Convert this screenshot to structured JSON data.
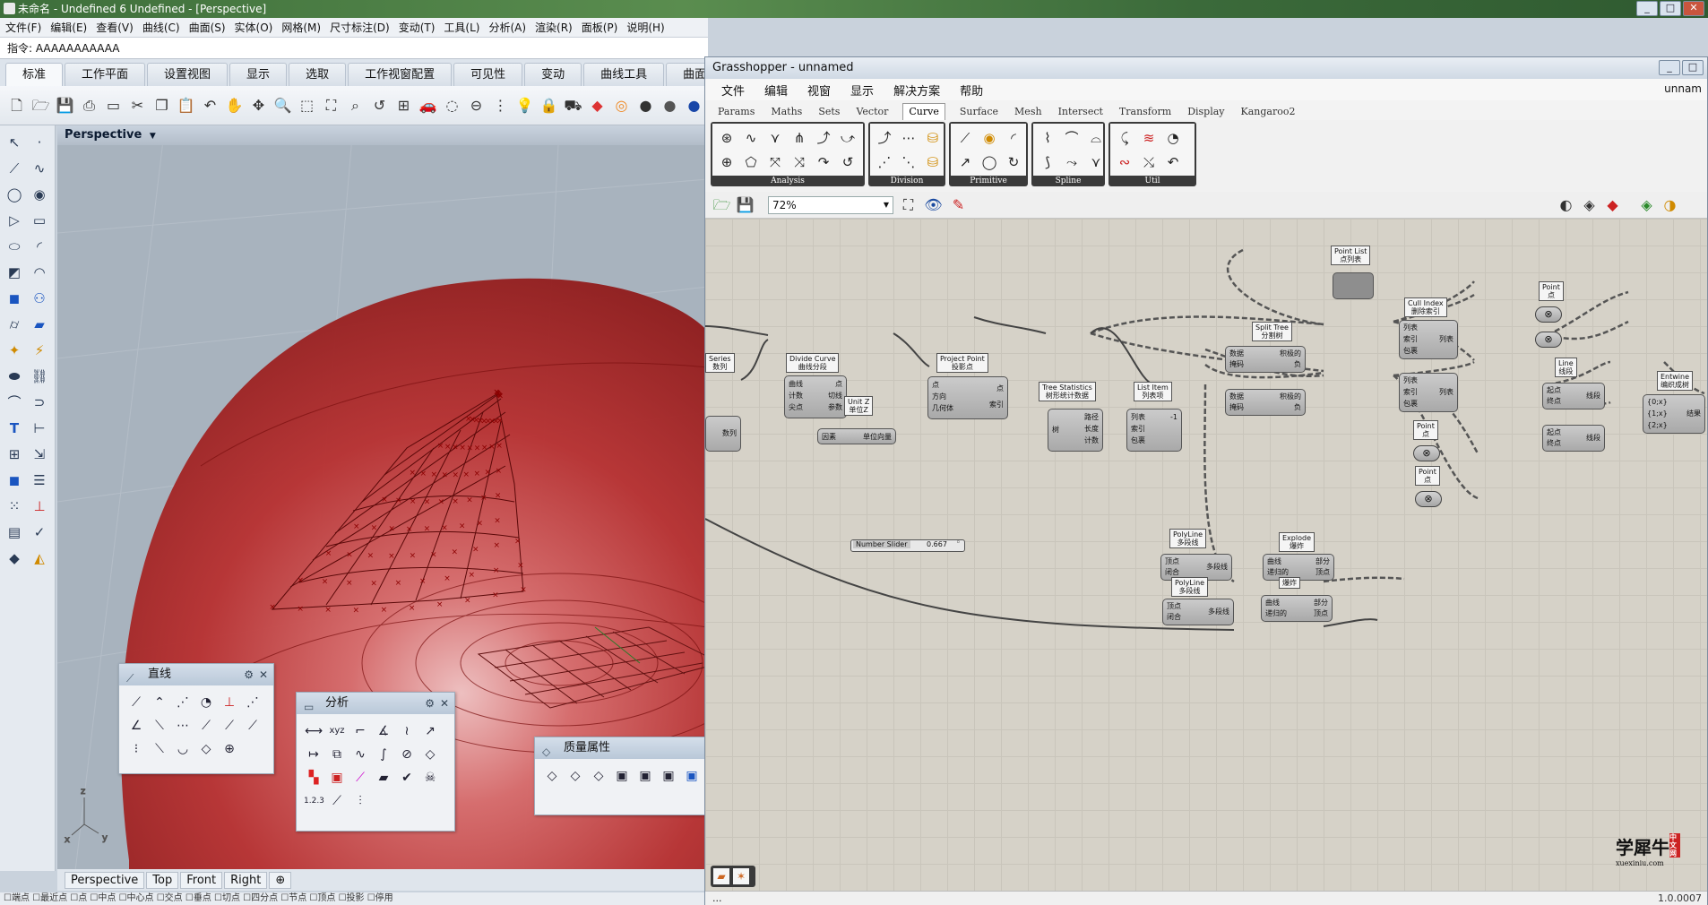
{
  "rhino": {
    "title": "未命名 - Undefined 6 Undefined - [Perspective]",
    "window_controls": [
      "_",
      "□",
      "✕"
    ],
    "menu": [
      "文件(F)",
      "编辑(E)",
      "查看(V)",
      "曲线(C)",
      "曲面(S)",
      "实体(O)",
      "网格(M)",
      "尺寸标注(D)",
      "变动(T)",
      "工具(L)",
      "分析(A)",
      "渲染(R)",
      "面板(P)",
      "说明(H)"
    ],
    "command": "指令: AAAAAAAAAAA",
    "tabs": [
      "标准",
      "工作平面",
      "设置视图",
      "显示",
      "选取",
      "工作视窗配置",
      "可见性",
      "变动",
      "曲线工具",
      "曲面工"
    ],
    "viewport_title": "Perspective",
    "viewport_tabs": [
      "Perspective",
      "Top",
      "Front",
      "Right",
      "⊕"
    ],
    "status": "☐端点 ☐最近点 ☐点 ☐中点 ☐中心点 ☐交点 ☐垂点 ☐切点 ☐四分点 ☐节点 ☐顶点 ☐投影 ☐停用",
    "axis_labels": {
      "z": "z",
      "x": "x",
      "y": "y"
    }
  },
  "panels": {
    "line": {
      "title": "直线",
      "gear": "⚙",
      "close": "✕"
    },
    "analysis": {
      "title": "分析",
      "gear": "⚙",
      "close": "✕",
      "number_label": "1.2.3"
    },
    "mass": {
      "title": "质量属性",
      "gear": "⚙",
      "close": "✕"
    }
  },
  "gh": {
    "title": "Grasshopper - unnamed",
    "menu": [
      "文件",
      "编辑",
      "视窗",
      "显示",
      "解决方案",
      "帮助"
    ],
    "menu_right": "unnam",
    "tabs": [
      "Params",
      "Maths",
      "Sets",
      "Vector",
      "Curve",
      "Surface",
      "Mesh",
      "Intersect",
      "Transform",
      "Display",
      "Kangaroo2"
    ],
    "active_tab": "Curve",
    "ribbon_groups": [
      "Analysis",
      "Division",
      "Primitive",
      "Spline",
      "Util"
    ],
    "zoom": "72%",
    "status_left": "...",
    "version": "1.0.0007",
    "slider_label": "Number Slider",
    "slider_value": "0.667",
    "watermark": "学犀牛",
    "watermark_badge": "中文网",
    "watermark_sub": "xuexiniu.com"
  },
  "nodes": {
    "series": {
      "tag": "Series",
      "tag2": "数列",
      "out": "数列"
    },
    "divide": {
      "tag": "Divide Curve",
      "tag2": "曲线分段",
      "in1": "曲线",
      "in2": "计数",
      "in3": "尖点",
      "out1": "点",
      "out2": "切线",
      "out3": "参数"
    },
    "unitz": {
      "tag": "Unit Z",
      "tag2": "单位Z",
      "in": "因素",
      "out": "单位向量"
    },
    "project": {
      "tag": "Project Point",
      "tag2": "投影点",
      "in1": "点",
      "in2": "方向",
      "in3": "几何体",
      "out1": "点",
      "out2": "索引"
    },
    "stats": {
      "tag": "Tree Statistics",
      "tag2": "树形统计数据",
      "in": "树",
      "out1": "路径",
      "out2": "长度",
      "out3": "计数"
    },
    "listitem": {
      "tag": "List Item",
      "tag2": "列表项",
      "in1": "列表",
      "in2": "索引",
      "in3": "包裹",
      "out": "-1"
    },
    "split1": {
      "tag": "Split Tree",
      "tag2": "分割树",
      "in1": "数据",
      "in2": "掩码",
      "out1": "积极的",
      "out2": "负"
    },
    "split2": {
      "in1": "数据",
      "in2": "掩码",
      "out1": "积极的",
      "out2": "负"
    },
    "pointlist": {
      "tag": "Point List",
      "tag2": "点列表"
    },
    "cull1": {
      "tag": "Cull Index",
      "tag2": "删除索引",
      "in1": "列表",
      "in2": "索引",
      "in3": "包裹",
      "out": "列表"
    },
    "cull2": {
      "in1": "列表",
      "in2": "索引",
      "in3": "包裹",
      "out": "列表"
    },
    "point1": {
      "tag": "Point",
      "tag2": "点"
    },
    "point2": {
      "tag": "Point",
      "tag2": "点"
    },
    "point3": {
      "tag": "Point",
      "tag2": "点"
    },
    "line": {
      "tag": "Line",
      "tag2": "线段",
      "in1": "起点",
      "in2": "终点",
      "out": "线段"
    },
    "line2": {
      "in1": "起点",
      "in2": "终点",
      "out": "线段"
    },
    "entwine": {
      "tag": "Entwine",
      "tag2": "编织成树",
      "in1": "{0;x}",
      "in2": "{1;x}",
      "in3": "{2;x}",
      "out": "结果"
    },
    "polyline1": {
      "tag": "PolyLine",
      "tag2": "多段线",
      "in1": "顶点",
      "in2": "闭合",
      "out": "多段线"
    },
    "polyline2": {
      "tag": "PolyLine",
      "tag2": "多段线",
      "in1": "顶点",
      "in2": "闭合",
      "out": "多段线"
    },
    "explode1": {
      "tag": "Explode",
      "tag2": "爆炸",
      "in1": "曲线",
      "in2": "递归的",
      "out1": "部分",
      "out2": "顶点"
    },
    "explode2": {
      "tag": "爆炸",
      "in1": "曲线",
      "in2": "递归的",
      "out1": "部分",
      "out2": "顶点"
    }
  },
  "colors": {
    "surface_red": "#c02a2a",
    "grid_bg": "#d6d2c8",
    "node_grey": "#b8b8b8"
  }
}
